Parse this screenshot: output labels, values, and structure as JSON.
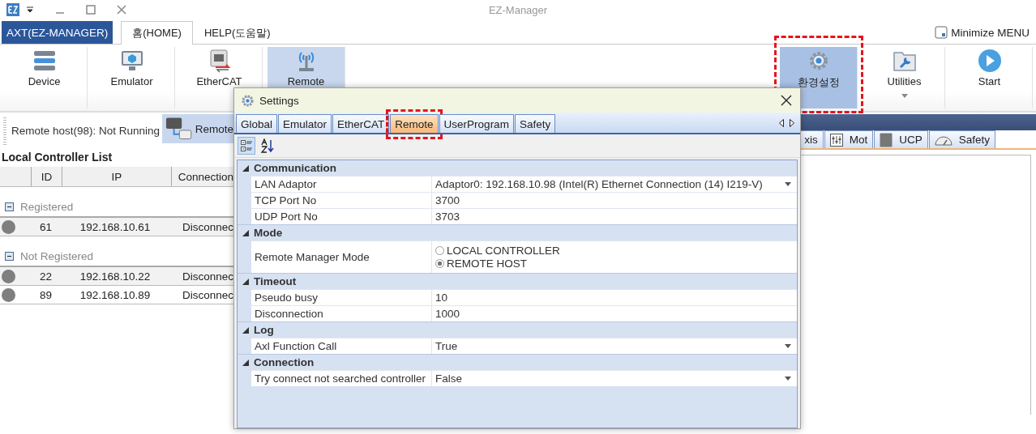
{
  "window": {
    "title": "EZ-Manager"
  },
  "app_menu": {
    "label": "AXT(EZ-MANAGER)"
  },
  "ribbon_tabs": [
    {
      "label": "홈(HOME)",
      "selected": true
    },
    {
      "label": "HELP(도움말)",
      "selected": false
    }
  ],
  "minimize_menu": {
    "label": "Minimize MENU"
  },
  "ribbon_buttons": [
    {
      "label": "Device",
      "kind": "device",
      "selected": false,
      "highlighted": false,
      "dropdown": false
    },
    {
      "label": "Emulator",
      "kind": "emulator",
      "selected": false,
      "highlighted": false,
      "dropdown": false
    },
    {
      "label": "EtherCAT",
      "kind": "ethercat",
      "selected": false,
      "highlighted": false,
      "dropdown": false
    },
    {
      "label": "Remote",
      "kind": "remote",
      "selected": true,
      "highlighted": false,
      "dropdown": false
    }
  ],
  "ribbon_buttons_right": [
    {
      "label": "환경설정",
      "kind": "settings",
      "selected": true,
      "highlighted": true,
      "dropdown": false
    },
    {
      "label": "Utilities",
      "kind": "utilities",
      "selected": false,
      "highlighted": false,
      "dropdown": true
    },
    {
      "label": "Start",
      "kind": "start",
      "selected": false,
      "highlighted": false,
      "dropdown": false
    }
  ],
  "status": {
    "text": "Remote host(98): Not Running",
    "remote_button": {
      "label": "Remote",
      "selected": true
    }
  },
  "controller_list": {
    "title": "Local Controller List",
    "columns": [
      "ID",
      "IP",
      "Connection"
    ],
    "groups": [
      {
        "name": "Registered",
        "expanded": true,
        "rows": [
          {
            "id": "61",
            "ip": "192.168.10.61",
            "connection": "Disconnec"
          }
        ]
      },
      {
        "name": "Not Registered",
        "expanded": true,
        "rows": [
          {
            "id": "22",
            "ip": "192.168.10.22",
            "connection": "Disconnec"
          },
          {
            "id": "89",
            "ip": "192.168.10.89",
            "connection": "Disconnec"
          }
        ]
      }
    ]
  },
  "side_panel": {
    "tabs": [
      {
        "label": "xis",
        "kind": "axis"
      },
      {
        "label": "Mot",
        "kind": "motion"
      },
      {
        "label": "UCP",
        "kind": "ucp"
      },
      {
        "label": "Safety",
        "kind": "safety"
      }
    ]
  },
  "settings_dialog": {
    "title": "Settings",
    "tabs": [
      {
        "label": "Global",
        "selected": false,
        "highlighted": false
      },
      {
        "label": "Emulator",
        "selected": false,
        "highlighted": false
      },
      {
        "label": "EtherCAT",
        "selected": false,
        "highlighted": false
      },
      {
        "label": "Remote",
        "selected": true,
        "highlighted": true
      },
      {
        "label": "UserProgram",
        "selected": false,
        "highlighted": false
      },
      {
        "label": "Safety",
        "selected": false,
        "highlighted": false
      }
    ],
    "toolbar": [
      {
        "kind": "categorized",
        "selected": true
      },
      {
        "kind": "alphabetical",
        "selected": false
      }
    ],
    "categories": [
      {
        "name": "Communication",
        "expanded": true,
        "properties": [
          {
            "name": "LAN Adaptor",
            "kind": "dropdown",
            "value": "Adaptor0: 192.168.10.98 (Intel(R) Ethernet Connection (14) I219-V)"
          },
          {
            "name": "TCP Port No",
            "kind": "text",
            "value": "3700"
          },
          {
            "name": "UDP Port No",
            "kind": "text",
            "value": "3703"
          }
        ]
      },
      {
        "name": "Mode",
        "expanded": true,
        "properties": [
          {
            "name": "Remote Manager Mode",
            "kind": "radio",
            "options": [
              {
                "label": "LOCAL CONTROLLER",
                "selected": false
              },
              {
                "label": "REMOTE HOST",
                "selected": true
              }
            ]
          }
        ]
      },
      {
        "name": "Timeout",
        "expanded": true,
        "properties": [
          {
            "name": "Pseudo busy",
            "kind": "text",
            "value": "10"
          },
          {
            "name": "Disconnection",
            "kind": "text",
            "value": "1000"
          }
        ]
      },
      {
        "name": "Log",
        "expanded": true,
        "properties": [
          {
            "name": "Axl Function Call",
            "kind": "dropdown",
            "value": "True"
          }
        ]
      },
      {
        "name": "Connection",
        "expanded": true,
        "properties": [
          {
            "name": "Try connect not searched controller",
            "kind": "dropdown",
            "value": "False"
          }
        ]
      }
    ]
  }
}
